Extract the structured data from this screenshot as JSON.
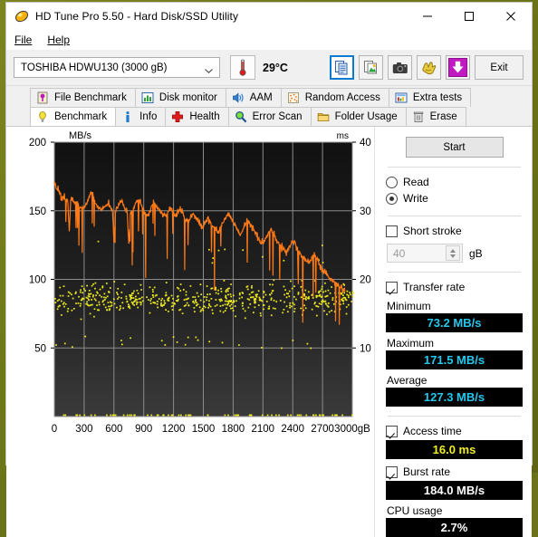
{
  "window": {
    "title": "HD Tune Pro 5.50 - Hard Disk/SSD Utility",
    "app_icon": "hdtune-diamond-icon",
    "minimize": "—",
    "maximize": "□",
    "close": "✕"
  },
  "menu": {
    "items": [
      {
        "label": "File",
        "mnemonic": "F"
      },
      {
        "label": "Help",
        "mnemonic": "H"
      }
    ]
  },
  "toolbar": {
    "drive": "TOSHIBA HDWU130 (3000 gB)",
    "drive_chevron": "chevron-down-icon",
    "temperature": "29°C",
    "thermometer_icon": "thermometer-icon",
    "buttons": [
      {
        "name": "copy-text-button",
        "icon": "copy-document-icon",
        "selected": true
      },
      {
        "name": "copy-image-button",
        "icon": "copy-image-icon",
        "selected": false
      },
      {
        "name": "screenshot-button",
        "icon": "camera-icon",
        "selected": false
      },
      {
        "name": "options-button",
        "icon": "gloves-icon",
        "selected": false
      },
      {
        "name": "save-button",
        "icon": "download-arrow-icon",
        "selected": false
      }
    ],
    "exit_label": "Exit"
  },
  "tabs": {
    "row1": [
      {
        "label": "File Benchmark",
        "icon": "file-benchmark-icon",
        "active": false
      },
      {
        "label": "Disk monitor",
        "icon": "bar-chart-icon",
        "active": false
      },
      {
        "label": "AAM",
        "icon": "speaker-icon",
        "active": false
      },
      {
        "label": "Random Access",
        "icon": "random-access-icon",
        "active": false
      },
      {
        "label": "Extra tests",
        "icon": "extra-tests-icon",
        "active": false
      }
    ],
    "row2": [
      {
        "label": "Benchmark",
        "icon": "lightbulb-icon",
        "active": true
      },
      {
        "label": "Info",
        "icon": "info-icon",
        "active": false
      },
      {
        "label": "Health",
        "icon": "red-cross-icon",
        "active": false
      },
      {
        "label": "Error Scan",
        "icon": "magnifier-icon",
        "active": false
      },
      {
        "label": "Folder Usage",
        "icon": "folder-icon",
        "active": false
      },
      {
        "label": "Erase",
        "icon": "trash-icon",
        "active": false
      }
    ]
  },
  "panel": {
    "start_label": "Start",
    "mode_read": "Read",
    "mode_write": "Write",
    "mode_selected": "Write",
    "short_stroke_label": "Short stroke",
    "short_stroke_checked": false,
    "short_stroke_value": "40",
    "short_stroke_unit": "gB",
    "transfer_rate_label": "Transfer rate",
    "transfer_rate_checked": true,
    "minimum_label": "Minimum",
    "minimum_value": "73.2 MB/s",
    "maximum_label": "Maximum",
    "maximum_value": "171.5 MB/s",
    "average_label": "Average",
    "average_value": "127.3 MB/s",
    "access_time_label": "Access time",
    "access_time_checked": true,
    "access_time_value": "16.0 ms",
    "burst_rate_label": "Burst rate",
    "burst_rate_checked": true,
    "burst_rate_value": "184.0 MB/s",
    "cpu_usage_label": "CPU usage",
    "cpu_usage_value": "2.7%"
  },
  "chart_data": {
    "type": "line",
    "title": "",
    "xlabel": "3000gB",
    "ylabel": "MB/s",
    "y2label": "ms",
    "xlim": [
      0,
      3000
    ],
    "ylim": [
      0,
      200
    ],
    "y2lim": [
      0,
      40
    ],
    "x_ticks": [
      0,
      300,
      600,
      900,
      1200,
      1500,
      1800,
      2100,
      2400,
      2700,
      3000
    ],
    "x_tick_labels": [
      "0",
      "300",
      "600",
      "900",
      "1200",
      "1500",
      "1800",
      "2100",
      "2400",
      "2700",
      "3000gB"
    ],
    "y_ticks": [
      50,
      100,
      150,
      200
    ],
    "y_tick_labels": [
      "50",
      "100",
      "150",
      "200"
    ],
    "y2_ticks": [
      10,
      20,
      30,
      40
    ],
    "y2_tick_labels": [
      "10",
      "20",
      "30",
      "40"
    ],
    "grid": true,
    "legend_position": "none",
    "plot_bg": "#1a1a1a",
    "series": [
      {
        "name": "Transfer rate",
        "type": "line",
        "color": "#ff7a18",
        "axis": "left",
        "units": "MB/s",
        "x": [
          0,
          15,
          30,
          45,
          60,
          75,
          90,
          105,
          120,
          135,
          150,
          165,
          180,
          195,
          210,
          225,
          240,
          255,
          270,
          285,
          300,
          315,
          330,
          345,
          360,
          375,
          390,
          405,
          420,
          435,
          450,
          465,
          480,
          495,
          510,
          525,
          540,
          555,
          570,
          585,
          600,
          615,
          630,
          645,
          660,
          675,
          690,
          705,
          720,
          735,
          750,
          765,
          780,
          795,
          810,
          825,
          840,
          855,
          870,
          885,
          900,
          915,
          930,
          945,
          960,
          975,
          990,
          1005,
          1020,
          1035,
          1050,
          1065,
          1080,
          1095,
          1110,
          1125,
          1140,
          1155,
          1170,
          1185,
          1200,
          1215,
          1230,
          1245,
          1260,
          1275,
          1290,
          1305,
          1320,
          1335,
          1350,
          1365,
          1380,
          1395,
          1410,
          1425,
          1440,
          1455,
          1470,
          1485,
          1500,
          1515,
          1530,
          1545,
          1560,
          1575,
          1590,
          1605,
          1620,
          1635,
          1650,
          1665,
          1680,
          1695,
          1710,
          1725,
          1740,
          1755,
          1770,
          1785,
          1800,
          1815,
          1830,
          1845,
          1860,
          1875,
          1890,
          1905,
          1920,
          1935,
          1950,
          1965,
          1980,
          1995,
          2010,
          2025,
          2040,
          2055,
          2070,
          2085,
          2100,
          2115,
          2130,
          2145,
          2160,
          2175,
          2190,
          2205,
          2220,
          2235,
          2250,
          2265,
          2280,
          2295,
          2310,
          2325,
          2340,
          2355,
          2370,
          2385,
          2400,
          2415,
          2430,
          2445,
          2460,
          2475,
          2490,
          2505,
          2520,
          2535,
          2550,
          2565,
          2580,
          2595,
          2610,
          2625,
          2640,
          2655,
          2670,
          2685,
          2700,
          2715,
          2730,
          2745,
          2760,
          2775,
          2790,
          2805,
          2820,
          2835,
          2850,
          2865,
          2880,
          2895,
          2910,
          2925,
          2940,
          2955,
          2970,
          2985,
          3000
        ],
        "y": [
          171.5,
          168,
          166,
          164,
          162,
          160,
          160,
          159,
          158,
          157,
          135,
          158,
          158,
          157,
          156,
          156,
          155,
          152,
          152,
          153,
          153,
          154,
          156,
          159,
          162,
          163,
          161,
          158,
          155,
          153,
          152,
          151,
          151,
          152,
          153,
          154,
          155,
          154,
          152,
          150,
          127,
          150,
          152,
          154,
          156,
          157,
          155,
          152,
          150,
          148,
          126,
          148,
          150,
          152,
          154,
          156,
          158,
          157,
          155,
          152,
          151,
          149,
          147,
          146,
          150,
          153,
          155,
          156,
          154,
          152,
          151,
          150,
          149,
          148,
          147,
          146,
          148,
          150,
          152,
          150,
          148,
          146,
          147,
          149,
          151,
          150,
          148,
          146,
          144,
          143,
          142,
          144,
          146,
          148,
          147,
          145,
          143,
          141,
          140,
          139,
          138,
          140,
          142,
          144,
          143,
          141,
          139,
          138,
          137,
          136,
          135,
          137,
          139,
          141,
          143,
          145,
          147,
          148,
          146,
          144,
          142,
          140,
          138,
          136,
          134,
          133,
          135,
          137,
          139,
          141,
          143,
          142,
          140,
          138,
          136,
          134,
          132,
          130,
          128,
          127,
          126,
          128,
          130,
          132,
          134,
          136,
          135,
          133,
          131,
          129,
          127,
          125,
          124,
          123,
          122,
          121,
          120,
          122,
          124,
          126,
          128,
          127,
          125,
          123,
          121,
          119,
          117,
          116,
          115,
          114,
          113,
          112,
          114,
          116,
          118,
          117,
          115,
          113,
          111,
          109,
          107,
          105,
          104,
          103,
          102,
          101,
          100,
          99,
          98,
          97,
          96,
          95,
          94,
          93,
          92,
          91
        ]
      },
      {
        "name": "Access time",
        "type": "scatter",
        "color": "#f2ef1c",
        "axis": "right",
        "units": "ms",
        "average_ms": 16.0,
        "range_ms": [
          13.0,
          22.5
        ],
        "point_count": 620
      }
    ]
  }
}
